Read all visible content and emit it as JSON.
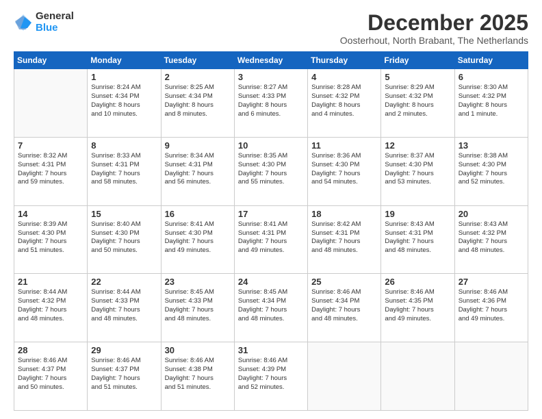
{
  "logo": {
    "general": "General",
    "blue": "Blue"
  },
  "title": "December 2025",
  "subtitle": "Oosterhout, North Brabant, The Netherlands",
  "headers": [
    "Sunday",
    "Monday",
    "Tuesday",
    "Wednesday",
    "Thursday",
    "Friday",
    "Saturday"
  ],
  "rows": [
    [
      {
        "day": "",
        "info": ""
      },
      {
        "day": "1",
        "info": "Sunrise: 8:24 AM\nSunset: 4:34 PM\nDaylight: 8 hours\nand 10 minutes."
      },
      {
        "day": "2",
        "info": "Sunrise: 8:25 AM\nSunset: 4:34 PM\nDaylight: 8 hours\nand 8 minutes."
      },
      {
        "day": "3",
        "info": "Sunrise: 8:27 AM\nSunset: 4:33 PM\nDaylight: 8 hours\nand 6 minutes."
      },
      {
        "day": "4",
        "info": "Sunrise: 8:28 AM\nSunset: 4:32 PM\nDaylight: 8 hours\nand 4 minutes."
      },
      {
        "day": "5",
        "info": "Sunrise: 8:29 AM\nSunset: 4:32 PM\nDaylight: 8 hours\nand 2 minutes."
      },
      {
        "day": "6",
        "info": "Sunrise: 8:30 AM\nSunset: 4:32 PM\nDaylight: 8 hours\nand 1 minute."
      }
    ],
    [
      {
        "day": "7",
        "info": "Sunrise: 8:32 AM\nSunset: 4:31 PM\nDaylight: 7 hours\nand 59 minutes."
      },
      {
        "day": "8",
        "info": "Sunrise: 8:33 AM\nSunset: 4:31 PM\nDaylight: 7 hours\nand 58 minutes."
      },
      {
        "day": "9",
        "info": "Sunrise: 8:34 AM\nSunset: 4:31 PM\nDaylight: 7 hours\nand 56 minutes."
      },
      {
        "day": "10",
        "info": "Sunrise: 8:35 AM\nSunset: 4:30 PM\nDaylight: 7 hours\nand 55 minutes."
      },
      {
        "day": "11",
        "info": "Sunrise: 8:36 AM\nSunset: 4:30 PM\nDaylight: 7 hours\nand 54 minutes."
      },
      {
        "day": "12",
        "info": "Sunrise: 8:37 AM\nSunset: 4:30 PM\nDaylight: 7 hours\nand 53 minutes."
      },
      {
        "day": "13",
        "info": "Sunrise: 8:38 AM\nSunset: 4:30 PM\nDaylight: 7 hours\nand 52 minutes."
      }
    ],
    [
      {
        "day": "14",
        "info": "Sunrise: 8:39 AM\nSunset: 4:30 PM\nDaylight: 7 hours\nand 51 minutes."
      },
      {
        "day": "15",
        "info": "Sunrise: 8:40 AM\nSunset: 4:30 PM\nDaylight: 7 hours\nand 50 minutes."
      },
      {
        "day": "16",
        "info": "Sunrise: 8:41 AM\nSunset: 4:30 PM\nDaylight: 7 hours\nand 49 minutes."
      },
      {
        "day": "17",
        "info": "Sunrise: 8:41 AM\nSunset: 4:31 PM\nDaylight: 7 hours\nand 49 minutes."
      },
      {
        "day": "18",
        "info": "Sunrise: 8:42 AM\nSunset: 4:31 PM\nDaylight: 7 hours\nand 48 minutes."
      },
      {
        "day": "19",
        "info": "Sunrise: 8:43 AM\nSunset: 4:31 PM\nDaylight: 7 hours\nand 48 minutes."
      },
      {
        "day": "20",
        "info": "Sunrise: 8:43 AM\nSunset: 4:32 PM\nDaylight: 7 hours\nand 48 minutes."
      }
    ],
    [
      {
        "day": "21",
        "info": "Sunrise: 8:44 AM\nSunset: 4:32 PM\nDaylight: 7 hours\nand 48 minutes."
      },
      {
        "day": "22",
        "info": "Sunrise: 8:44 AM\nSunset: 4:33 PM\nDaylight: 7 hours\nand 48 minutes."
      },
      {
        "day": "23",
        "info": "Sunrise: 8:45 AM\nSunset: 4:33 PM\nDaylight: 7 hours\nand 48 minutes."
      },
      {
        "day": "24",
        "info": "Sunrise: 8:45 AM\nSunset: 4:34 PM\nDaylight: 7 hours\nand 48 minutes."
      },
      {
        "day": "25",
        "info": "Sunrise: 8:46 AM\nSunset: 4:34 PM\nDaylight: 7 hours\nand 48 minutes."
      },
      {
        "day": "26",
        "info": "Sunrise: 8:46 AM\nSunset: 4:35 PM\nDaylight: 7 hours\nand 49 minutes."
      },
      {
        "day": "27",
        "info": "Sunrise: 8:46 AM\nSunset: 4:36 PM\nDaylight: 7 hours\nand 49 minutes."
      }
    ],
    [
      {
        "day": "28",
        "info": "Sunrise: 8:46 AM\nSunset: 4:37 PM\nDaylight: 7 hours\nand 50 minutes."
      },
      {
        "day": "29",
        "info": "Sunrise: 8:46 AM\nSunset: 4:37 PM\nDaylight: 7 hours\nand 51 minutes."
      },
      {
        "day": "30",
        "info": "Sunrise: 8:46 AM\nSunset: 4:38 PM\nDaylight: 7 hours\nand 51 minutes."
      },
      {
        "day": "31",
        "info": "Sunrise: 8:46 AM\nSunset: 4:39 PM\nDaylight: 7 hours\nand 52 minutes."
      },
      {
        "day": "",
        "info": ""
      },
      {
        "day": "",
        "info": ""
      },
      {
        "day": "",
        "info": ""
      }
    ]
  ]
}
